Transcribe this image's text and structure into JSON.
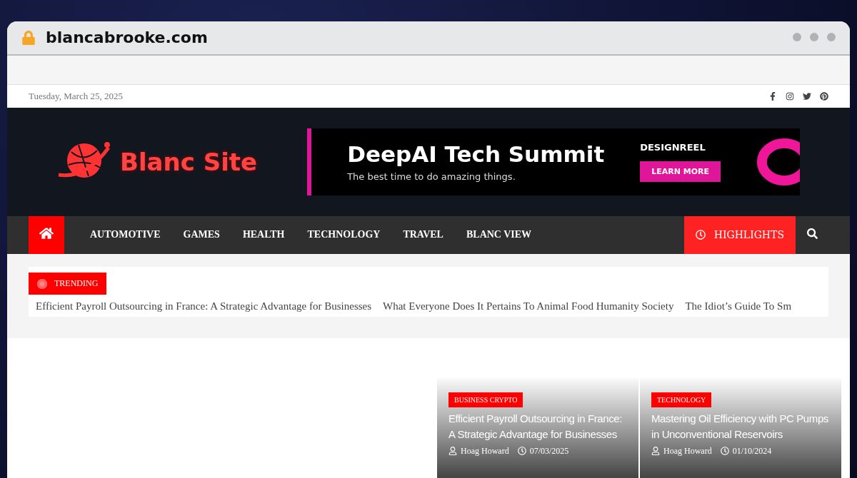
{
  "browser": {
    "url": "blancabrooke.com"
  },
  "topbar": {
    "date": "Tuesday, March 25, 2025"
  },
  "header": {
    "logo": "Blanc Site",
    "banner": {
      "title": "DeepAI Tech Summit",
      "tagline": "The best time to do amazing things.",
      "brand": "DESIGNREEL",
      "button": "LEARN MORE"
    }
  },
  "nav": {
    "items": [
      {
        "label": "AUTOMOTIVE",
        "selected": false
      },
      {
        "label": "GAMES",
        "selected": false
      },
      {
        "label": "HEALTH",
        "selected": false
      },
      {
        "label": "TECHNOLOGY",
        "selected": false
      },
      {
        "label": "TRAVEL",
        "selected": false
      },
      {
        "label": "BLANC VIEW",
        "selected": false
      }
    ],
    "highlights": "HIGHLIGHTS"
  },
  "trending": {
    "label": "TRENDING",
    "items": [
      "Efficient Payroll Outsourcing in France: A Strategic Advantage for Businesses",
      "What Everyone Does It Pertains To Animal Food Humanity Society",
      "The Idiot’s Guide To Sm"
    ]
  },
  "cards": [
    {
      "category": "BUSINESS CRYPTO",
      "title": "Efficient Payroll Outsourcing in France: A Strategic Advantage for Businesses",
      "author": "Hoag Howard",
      "date": "07/03/2025"
    },
    {
      "category": "TECHNOLOGY",
      "title": "Mastering Oil Efficiency with PC Pumps in Unconventional Reservoirs",
      "author": "Hoag Howard",
      "date": "01/10/2024"
    }
  ]
}
